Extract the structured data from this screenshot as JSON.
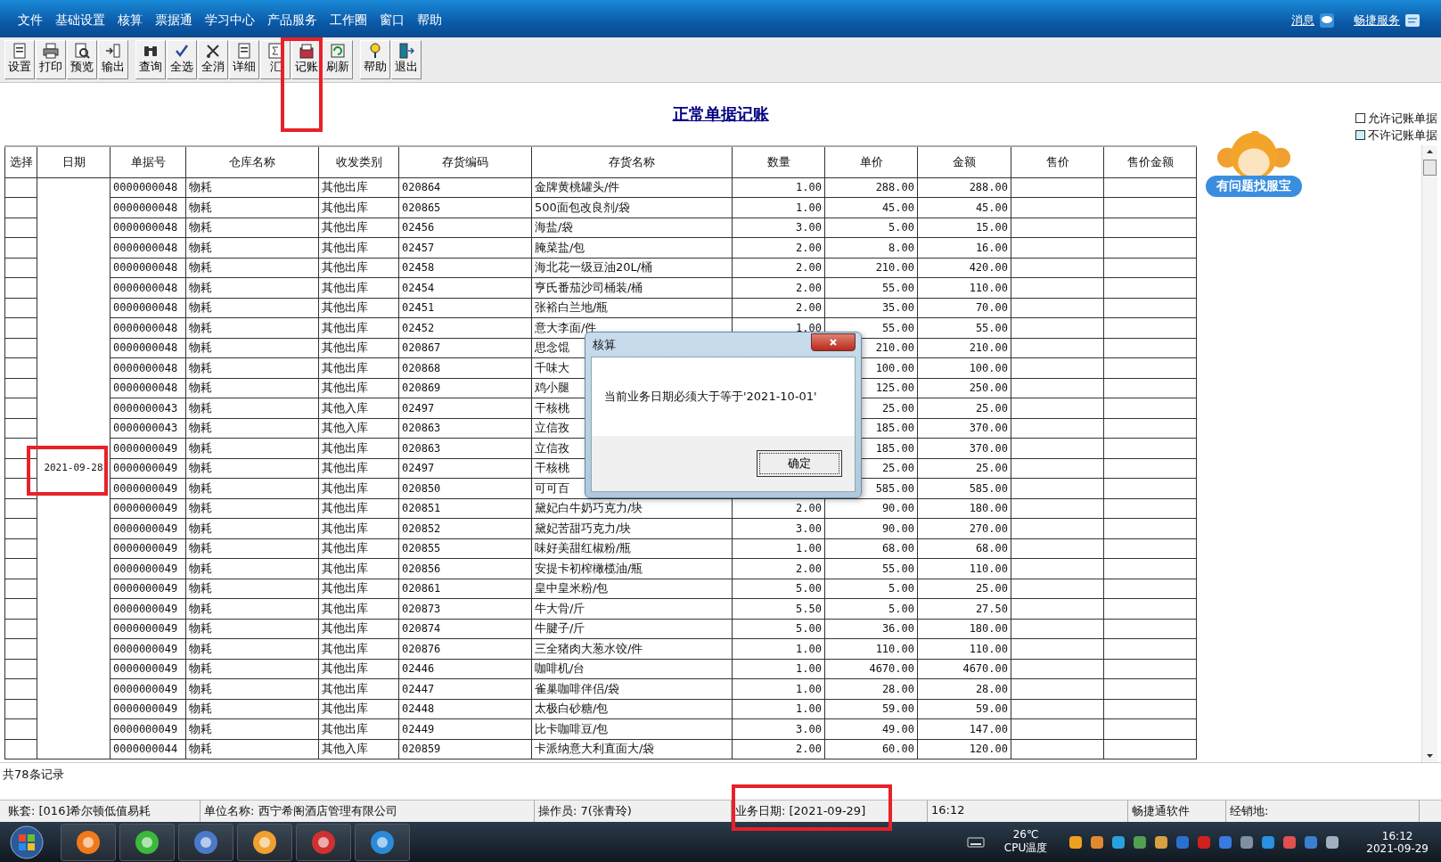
{
  "menu": [
    "文件",
    "基础设置",
    "核算",
    "票据通",
    "学习中心",
    "产品服务",
    "工作圈",
    "窗口",
    "帮助"
  ],
  "top_links": [
    {
      "label": "消息",
      "kind": "message"
    },
    {
      "label": "畅捷服务",
      "kind": "service"
    }
  ],
  "toolbar_groups": [
    {
      "buttons": [
        {
          "label": "设置",
          "kind": "page"
        },
        {
          "label": "打印",
          "kind": "print"
        },
        {
          "label": "预览",
          "kind": "preview"
        },
        {
          "label": "输出",
          "kind": "export"
        }
      ]
    },
    {
      "buttons": [
        {
          "label": "查询",
          "kind": "binoculars"
        },
        {
          "label": "全选",
          "kind": "checkall"
        },
        {
          "label": "全消",
          "kind": "uncheck"
        },
        {
          "label": "详细",
          "kind": "detail"
        },
        {
          "label": "汇",
          "kind": "sum"
        },
        {
          "label": "记账",
          "kind": "post"
        },
        {
          "label": "刷新",
          "kind": "refresh"
        }
      ]
    },
    {
      "buttons": [
        {
          "label": "帮助",
          "kind": "help"
        },
        {
          "label": "退出",
          "kind": "exit"
        }
      ]
    }
  ],
  "title": "正常单据记账",
  "legend": [
    {
      "label": "允许记账单据",
      "color": "#ffffff"
    },
    {
      "label": "不许记账单据",
      "color": "#c8f4f8"
    }
  ],
  "helper": {
    "label": "有问题找服宝"
  },
  "table": {
    "columns": [
      "选择",
      "日期",
      "单据号",
      "仓库名称",
      "收发类别",
      "存货编码",
      "存货名称",
      "数量",
      "单价",
      "金额",
      "售价",
      "售价金额"
    ],
    "date": "2021-09-28",
    "rows": [
      {
        "no": "0000000048",
        "warehouse": "物耗",
        "type": "其他出库",
        "code": "020864",
        "name": "金牌黄桃罐头/件",
        "qty": "1.00",
        "price": "288.00",
        "amount": "288.00"
      },
      {
        "no": "0000000048",
        "warehouse": "物耗",
        "type": "其他出库",
        "code": "020865",
        "name": "500面包改良剂/袋",
        "qty": "1.00",
        "price": "45.00",
        "amount": "45.00"
      },
      {
        "no": "0000000048",
        "warehouse": "物耗",
        "type": "其他出库",
        "code": "02456",
        "name": "海盐/袋",
        "qty": "3.00",
        "price": "5.00",
        "amount": "15.00"
      },
      {
        "no": "0000000048",
        "warehouse": "物耗",
        "type": "其他出库",
        "code": "02457",
        "name": "腌菜盐/包",
        "qty": "2.00",
        "price": "8.00",
        "amount": "16.00"
      },
      {
        "no": "0000000048",
        "warehouse": "物耗",
        "type": "其他出库",
        "code": "02458",
        "name": "海北花一级豆油20L/桶",
        "qty": "2.00",
        "price": "210.00",
        "amount": "420.00"
      },
      {
        "no": "0000000048",
        "warehouse": "物耗",
        "type": "其他出库",
        "code": "02454",
        "name": "亨氏番茄沙司桶装/桶",
        "qty": "2.00",
        "price": "55.00",
        "amount": "110.00"
      },
      {
        "no": "0000000048",
        "warehouse": "物耗",
        "type": "其他出库",
        "code": "02451",
        "name": "张裕白兰地/瓶",
        "qty": "2.00",
        "price": "35.00",
        "amount": "70.00"
      },
      {
        "no": "0000000048",
        "warehouse": "物耗",
        "type": "其他出库",
        "code": "02452",
        "name": "意大李面/件",
        "qty": "1.00",
        "price": "55.00",
        "amount": "55.00"
      },
      {
        "no": "0000000048",
        "warehouse": "物耗",
        "type": "其他出库",
        "code": "020867",
        "name": "思念馄",
        "price": "210.00",
        "amount": "210.00"
      },
      {
        "no": "0000000048",
        "warehouse": "物耗",
        "type": "其他出库",
        "code": "020868",
        "name": "千味大",
        "price": "100.00",
        "amount": "100.00"
      },
      {
        "no": "0000000048",
        "warehouse": "物耗",
        "type": "其他出库",
        "code": "020869",
        "name": "鸡小腿",
        "price": "125.00",
        "amount": "250.00"
      },
      {
        "no": "0000000043",
        "warehouse": "物耗",
        "type": "其他入库",
        "code": "02497",
        "name": "干核桃",
        "price": "25.00",
        "amount": "25.00"
      },
      {
        "no": "0000000043",
        "warehouse": "物耗",
        "type": "其他入库",
        "code": "020863",
        "name": "立信孜",
        "price": "185.00",
        "amount": "370.00"
      },
      {
        "no": "0000000049",
        "warehouse": "物耗",
        "type": "其他出库",
        "code": "020863",
        "name": "立信孜",
        "price": "185.00",
        "amount": "370.00"
      },
      {
        "no": "0000000049",
        "warehouse": "物耗",
        "type": "其他出库",
        "code": "02497",
        "name": "干核桃",
        "price": "25.00",
        "amount": "25.00"
      },
      {
        "no": "0000000049",
        "warehouse": "物耗",
        "type": "其他出库",
        "code": "020850",
        "name": "可可百",
        "price": "585.00",
        "amount": "585.00"
      },
      {
        "no": "0000000049",
        "warehouse": "物耗",
        "type": "其他出库",
        "code": "020851",
        "name": "黛妃白牛奶巧克力/块",
        "qty": "2.00",
        "price": "90.00",
        "amount": "180.00"
      },
      {
        "no": "0000000049",
        "warehouse": "物耗",
        "type": "其他出库",
        "code": "020852",
        "name": "黛妃苦甜巧克力/块",
        "qty": "3.00",
        "price": "90.00",
        "amount": "270.00"
      },
      {
        "no": "0000000049",
        "warehouse": "物耗",
        "type": "其他出库",
        "code": "020855",
        "name": "味好美甜红椒粉/瓶",
        "qty": "1.00",
        "price": "68.00",
        "amount": "68.00"
      },
      {
        "no": "0000000049",
        "warehouse": "物耗",
        "type": "其他出库",
        "code": "020856",
        "name": "安提卡初榨橄榄油/瓶",
        "qty": "2.00",
        "price": "55.00",
        "amount": "110.00"
      },
      {
        "no": "0000000049",
        "warehouse": "物耗",
        "type": "其他出库",
        "code": "020861",
        "name": "皇中皇米粉/包",
        "qty": "5.00",
        "price": "5.00",
        "amount": "25.00"
      },
      {
        "no": "0000000049",
        "warehouse": "物耗",
        "type": "其他出库",
        "code": "020873",
        "name": "牛大骨/斤",
        "qty": "5.50",
        "price": "5.00",
        "amount": "27.50"
      },
      {
        "no": "0000000049",
        "warehouse": "物耗",
        "type": "其他出库",
        "code": "020874",
        "name": "牛腱子/斤",
        "qty": "5.00",
        "price": "36.00",
        "amount": "180.00"
      },
      {
        "no": "0000000049",
        "warehouse": "物耗",
        "type": "其他出库",
        "code": "020876",
        "name": "三全猪肉大葱水饺/件",
        "qty": "1.00",
        "price": "110.00",
        "amount": "110.00"
      },
      {
        "no": "0000000049",
        "warehouse": "物耗",
        "type": "其他出库",
        "code": "02446",
        "name": "咖啡机/台",
        "qty": "1.00",
        "price": "4670.00",
        "amount": "4670.00"
      },
      {
        "no": "0000000049",
        "warehouse": "物耗",
        "type": "其他出库",
        "code": "02447",
        "name": "雀巢咖啡伴侣/袋",
        "qty": "1.00",
        "price": "28.00",
        "amount": "28.00"
      },
      {
        "no": "0000000049",
        "warehouse": "物耗",
        "type": "其他出库",
        "code": "02448",
        "name": "太极白砂糖/包",
        "qty": "1.00",
        "price": "59.00",
        "amount": "59.00"
      },
      {
        "no": "0000000049",
        "warehouse": "物耗",
        "type": "其他出库",
        "code": "02449",
        "name": "比卡咖啡豆/包",
        "qty": "3.00",
        "price": "49.00",
        "amount": "147.00"
      },
      {
        "no": "0000000044",
        "warehouse": "物耗",
        "type": "其他入库",
        "code": "020859",
        "name": "卡派纳意大利直面大/袋",
        "qty": "2.00",
        "price": "60.00",
        "amount": "120.00"
      }
    ]
  },
  "record_count": "共78条记录",
  "status_bar": [
    "账套: [016]希尔顿低值易耗",
    "单位名称: 西宁希阁酒店管理有限公司",
    "操作员: 7(张青玲)",
    "业务日期: [2021-09-29]",
    "16:12",
    "畅捷通软件",
    "经销地:"
  ],
  "dialog": {
    "title": "核算",
    "message": "当前业务日期必须大于等于'2021-10-01'",
    "button": "确定"
  },
  "taskbar": {
    "apps": [
      {
        "kind": "firefox"
      },
      {
        "kind": "refresh"
      },
      {
        "kind": "computer"
      },
      {
        "kind": "monkey"
      },
      {
        "kind": "wine"
      },
      {
        "kind": "ie"
      }
    ],
    "temperature": "26℃",
    "temperature_label": "CPU温度",
    "time": "16:12",
    "date": "2021-09-29"
  }
}
